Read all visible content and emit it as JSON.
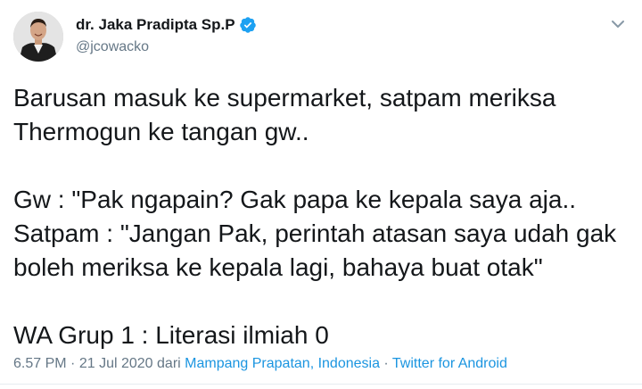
{
  "author": {
    "display_name": "dr. Jaka Pradipta Sp.P",
    "handle": "@jcowacko"
  },
  "tweet": {
    "lines": [
      "Barusan masuk ke supermarket, satpam meriksa",
      "Thermogun ke tangan gw..",
      "",
      "Gw : \"Pak ngapain? Gak papa ke kepala saya aja..",
      "Satpam : \"Jangan Pak, perintah atasan saya udah gak",
      "boleh meriksa ke kepala lagi, bahaya buat otak\"",
      "",
      "WA Grup 1 : Literasi ilmiah 0"
    ]
  },
  "meta": {
    "time": "6.57 PM",
    "separator": "·",
    "date": "21 Jul 2020",
    "from": "dari",
    "location": "Mampang Prapatan, Indonesia",
    "source": "Twitter for Android"
  },
  "icons": {
    "verified": "verified-badge-icon",
    "caret": "chevron-down-icon"
  },
  "colors": {
    "link": "#1b95e0",
    "verified": "#1da1f2",
    "muted": "#657786",
    "text": "#14171a"
  }
}
